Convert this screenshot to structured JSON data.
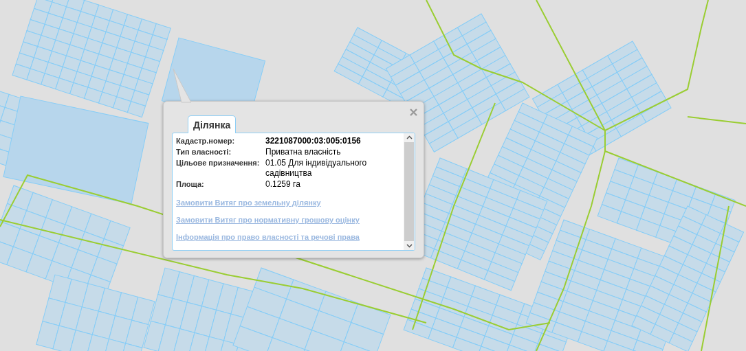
{
  "popup": {
    "tabs": [
      {
        "label": "Ділянка",
        "selected": true
      }
    ],
    "fields": [
      {
        "label": "Кадастр.номер:",
        "value": "3221087000:03:005:0156",
        "bold": true
      },
      {
        "label": "Тип власності:",
        "value": "Приватна власність",
        "bold": false
      },
      {
        "label": "Цільове призначення:",
        "value": "01.05 Для індивідуального садівництва",
        "bold": false
      },
      {
        "label": "Площа:",
        "value": "0.1259 га",
        "bold": false
      }
    ],
    "links": [
      "Замовити Витяг про земельну ділянку",
      "Замовити Витяг про нормативну грошову оцінку",
      "Інформація про право власності та речові права"
    ]
  }
}
